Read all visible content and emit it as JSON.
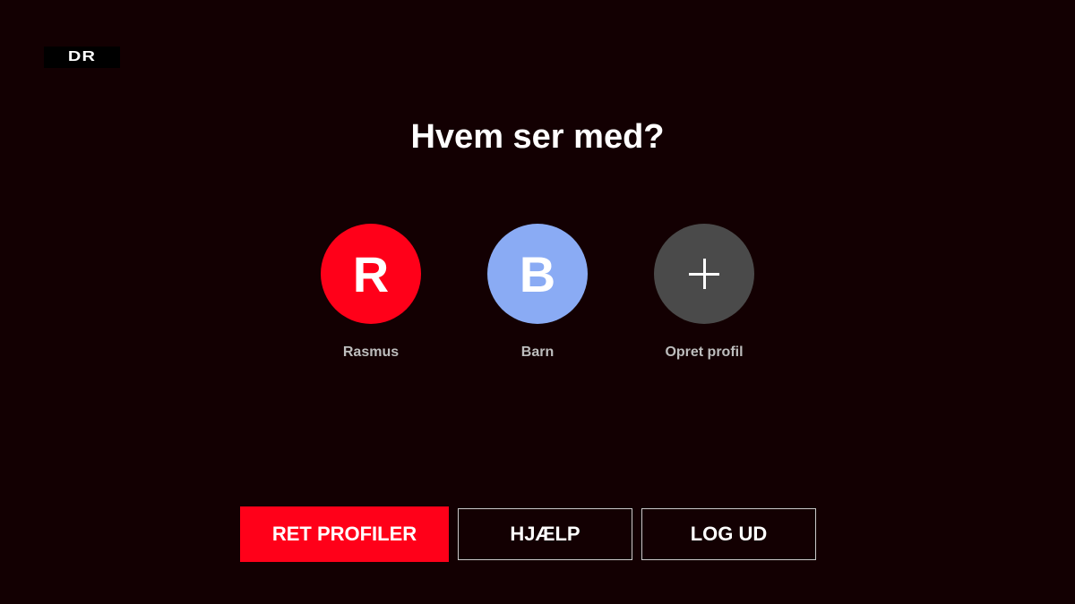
{
  "logo": {
    "text": "DR"
  },
  "title": "Hvem ser med?",
  "colors": {
    "background": "#130002",
    "accent": "#ff0019",
    "profile_r": "#ff0019",
    "profile_b": "#8aabf4",
    "profile_add": "#4a4a4a"
  },
  "profiles": [
    {
      "initial": "R",
      "name": "Rasmus",
      "color": "#ff0019"
    },
    {
      "initial": "B",
      "name": "Barn",
      "color": "#8aabf4"
    },
    {
      "icon": "plus-icon",
      "name": "Opret profil",
      "color": "#4a4a4a"
    }
  ],
  "actions": {
    "edit_profiles": "RET PROFILER",
    "help": "HJÆLP",
    "logout": "LOG UD"
  }
}
